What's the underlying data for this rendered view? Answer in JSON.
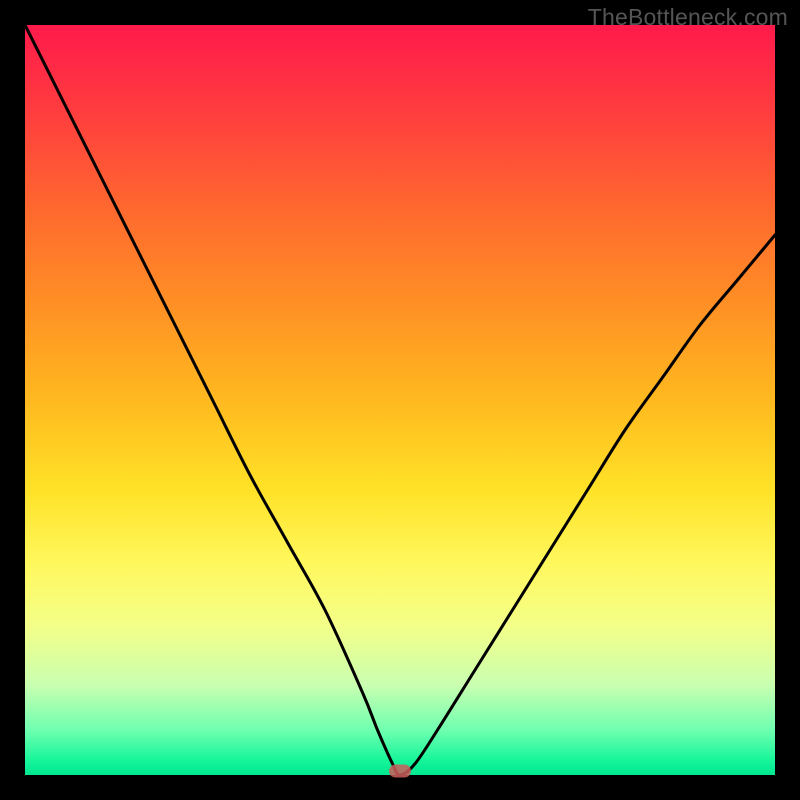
{
  "watermark": "TheBottleneck.com",
  "chart_data": {
    "type": "line",
    "title": "",
    "xlabel": "",
    "ylabel": "",
    "xlim": [
      0,
      100
    ],
    "ylim": [
      0,
      100
    ],
    "x": [
      0,
      5,
      10,
      15,
      20,
      25,
      30,
      35,
      40,
      45,
      47,
      49,
      50,
      52,
      55,
      60,
      65,
      70,
      75,
      80,
      85,
      90,
      95,
      100
    ],
    "values": [
      100,
      90,
      80,
      70,
      60,
      50,
      40,
      31,
      22,
      11,
      6,
      1.5,
      0,
      1.5,
      6,
      14,
      22,
      30,
      38,
      46,
      53,
      60,
      66,
      72
    ],
    "minimum": {
      "x": 50,
      "y": 0
    },
    "series_name": "bottleneck-curve"
  },
  "colors": {
    "frame": "#000000",
    "gradient_top": "#ff1a4b",
    "gradient_bottom": "#00e890",
    "curve": "#000000",
    "marker": "#cd5c5c"
  }
}
